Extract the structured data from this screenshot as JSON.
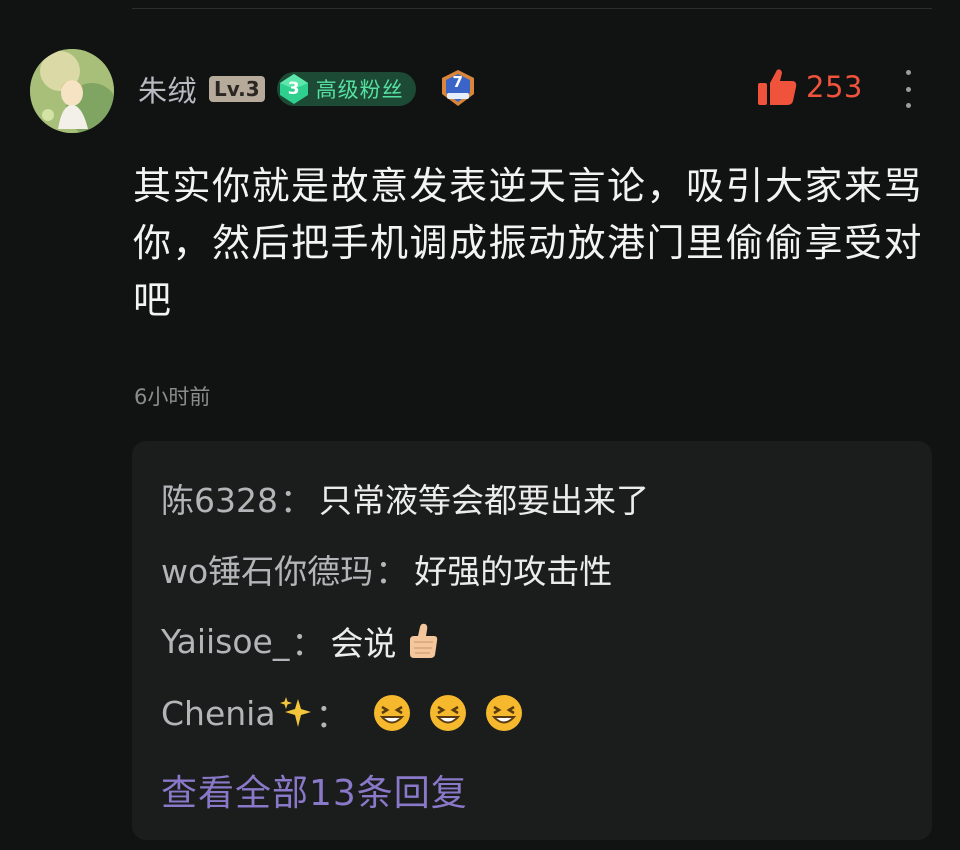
{
  "comment": {
    "user": {
      "name": "朱绒",
      "level": "Lv.3",
      "fan_badge_level": "3",
      "fan_badge_label": "高级粉丝",
      "medal_number": "7"
    },
    "likes": "253",
    "text": "其实你就是故意发表逆天言论，吸引大家来骂你，然后把手机调成振动放港门里偷偷享受对吧",
    "time": "6小时前",
    "icons": {
      "like": "thumbs-up-icon",
      "more": "more-vertical-icon"
    }
  },
  "replies": [
    {
      "name": "陈6328",
      "sep": "：",
      "text": "只常液等会都要出来了"
    },
    {
      "name": "wo锤石你德玛",
      "sep": "：",
      "text": "好强的攻击性"
    },
    {
      "name": "Yaiisoe_",
      "sep": "：",
      "text": "会说",
      "emoji": "thumbs-up-emoji"
    },
    {
      "name": "Chenia",
      "name_emoji": "sparkles-emoji",
      "sep": "：",
      "text": "",
      "emoji": "laughing-face-emoji",
      "emoji_count": 3
    }
  ],
  "view_all_label": "查看全部13条回复",
  "colors": {
    "background": "#111312",
    "reply_box": "#1b1d1c",
    "like": "#f0533c",
    "link": "#8a78c8",
    "fan_badge_text": "#56e0a2"
  }
}
